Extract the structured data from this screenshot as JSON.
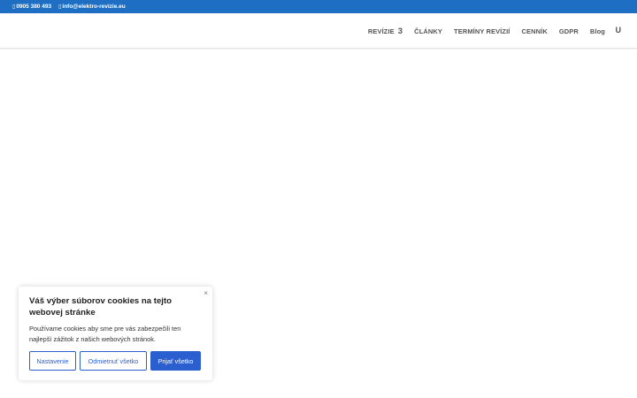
{
  "topbar": {
    "phone_icon": "phone-icon",
    "phone": "0905 380 493",
    "email_icon": "envelope-icon",
    "email": "info@elektro-revizie.eu"
  },
  "nav": {
    "items": [
      {
        "label": "REVÍZIE",
        "badge": "3"
      },
      {
        "label": "ČLÁNKY"
      },
      {
        "label": "TERMÍNY REVÍZIÍ"
      },
      {
        "label": "CENNÍK"
      },
      {
        "label": "GDPR"
      },
      {
        "label": "Blog"
      }
    ],
    "search_glyph": "U"
  },
  "cookie": {
    "close": "×",
    "title": "Váš výber súborov cookies na tejto webovej stránke",
    "description": "Používame cookies aby sme pre vás zabezpečili ten najlepší zážitok z našich webových stránok.",
    "settings_label": "Nastavenie",
    "reject_label": "Odmietnuť všetko",
    "accept_label": "Prijať všetko",
    "accent_color": "#2b5fd0"
  },
  "colors": {
    "topbar": "#1e6fc4"
  }
}
